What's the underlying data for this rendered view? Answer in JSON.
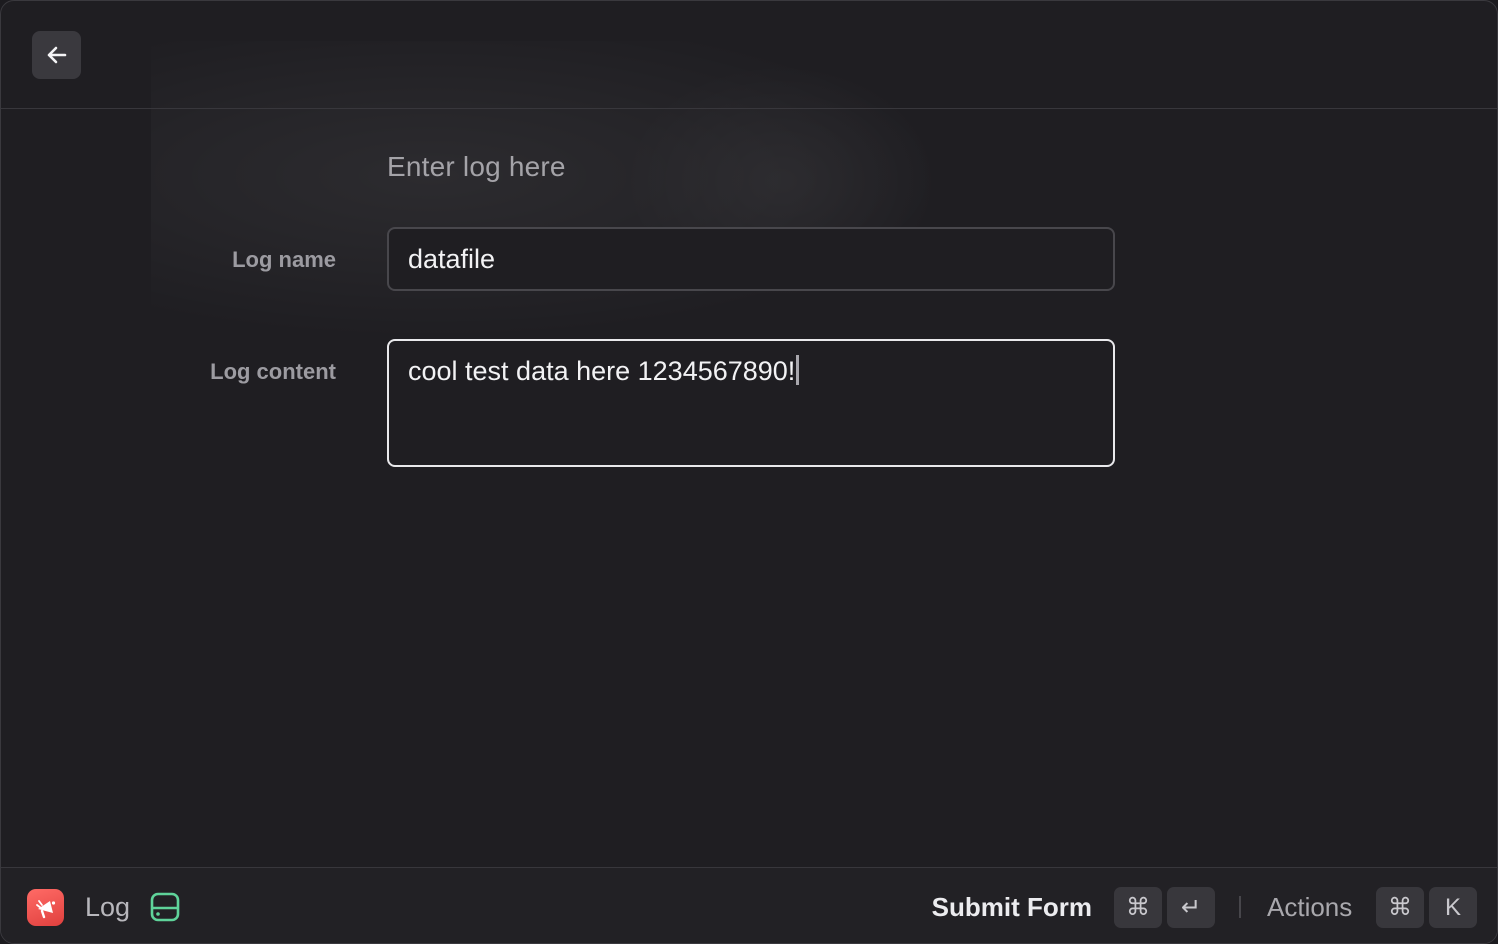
{
  "header": {
    "back_icon": "arrow-left-icon"
  },
  "form": {
    "description": "Enter log here",
    "fields": [
      {
        "label": "Log name",
        "value": "datafile"
      },
      {
        "label": "Log content",
        "value": "cool test data here 1234567890!"
      }
    ]
  },
  "footer": {
    "app_icon": "app-icon",
    "title": "Log",
    "status_icon": "hard-drive-icon",
    "status_icon_color": "#5fd39a",
    "app_icon_color": "#e8504c",
    "submit_label": "Submit Form",
    "submit_keys": [
      "⌘",
      "↵"
    ],
    "actions_label": "Actions",
    "actions_keys": [
      "⌘",
      "K"
    ]
  }
}
